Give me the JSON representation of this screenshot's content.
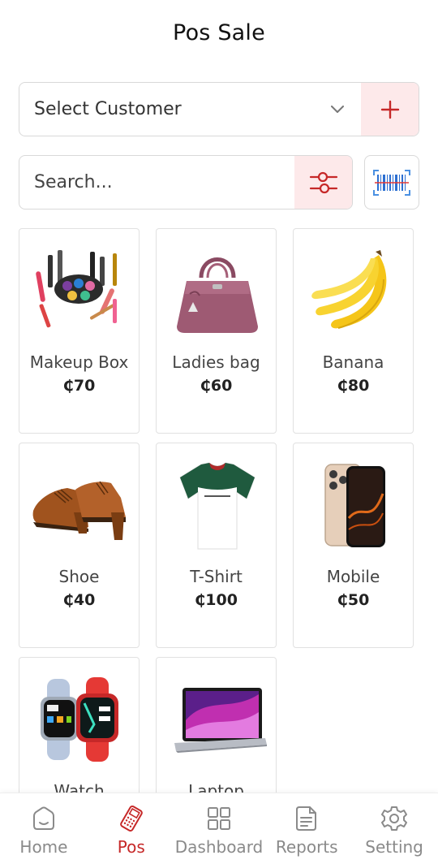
{
  "header": {
    "title": "Pos Sale"
  },
  "customer": {
    "select_label": "Select Customer"
  },
  "search": {
    "placeholder": "Search..."
  },
  "currency_symbol": "₵",
  "products": [
    {
      "name": "Makeup Box",
      "price": "₵70",
      "icon": "makeup-box-image"
    },
    {
      "name": "Ladies bag",
      "price": "₵60",
      "icon": "handbag-image"
    },
    {
      "name": "Banana",
      "price": "₵80",
      "icon": "banana-image"
    },
    {
      "name": "Shoe",
      "price": "₵40",
      "icon": "shoe-image"
    },
    {
      "name": "T-Shirt",
      "price": "₵100",
      "icon": "tshirt-image"
    },
    {
      "name": "Mobile",
      "price": "₵50",
      "icon": "mobile-image"
    },
    {
      "name": "Watch",
      "price": "",
      "icon": "watch-image"
    },
    {
      "name": "Laptop",
      "price": "",
      "icon": "laptop-image"
    }
  ],
  "nav": {
    "items": [
      {
        "label": "Home",
        "icon": "home-icon",
        "active": false
      },
      {
        "label": "Pos",
        "icon": "pos-terminal-icon",
        "active": true
      },
      {
        "label": "Dashboard",
        "icon": "dashboard-grid-icon",
        "active": false
      },
      {
        "label": "Reports",
        "icon": "reports-document-icon",
        "active": false
      },
      {
        "label": "Setting",
        "icon": "settings-gear-icon",
        "active": false
      }
    ]
  },
  "colors": {
    "accent": "#c62828",
    "accent_bg": "#fde9ea",
    "border": "#d9d9d9",
    "muted": "#8a8a8a"
  }
}
